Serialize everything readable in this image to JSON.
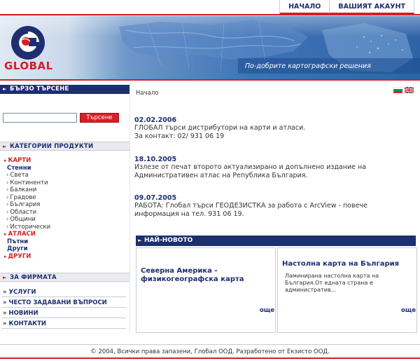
{
  "topnav": {
    "home": "НАЧАЛО",
    "account": "ВАШИЯТ АКАУНТ"
  },
  "banner": {
    "logo_text": "GLOBAL",
    "slogan": "По-добрите картографски решения"
  },
  "quick_search": {
    "title": "БЪРЗО ТЪРСЕНЕ",
    "button": "Търсене",
    "input_value": ""
  },
  "categories": {
    "title": "КАТЕГОРИИ ПРОДУКТИ",
    "items": [
      {
        "type": "main",
        "label": "КАРТИ"
      },
      {
        "type": "sub",
        "label": "Стенни"
      },
      {
        "type": "subsub",
        "label": "Света"
      },
      {
        "type": "subsub",
        "label": "Континенти"
      },
      {
        "type": "subsub",
        "label": "Балкани"
      },
      {
        "type": "subsub",
        "label": "Градове"
      },
      {
        "type": "subsub",
        "label": "България"
      },
      {
        "type": "subsub",
        "label": "Области"
      },
      {
        "type": "subsub",
        "label": "Общини"
      },
      {
        "type": "subsub",
        "label": "Исторически"
      },
      {
        "type": "main",
        "label": "АТЛАСИ"
      },
      {
        "type": "sub",
        "label": "Пътни"
      },
      {
        "type": "sub",
        "label": "Други"
      },
      {
        "type": "main",
        "label": "ДРУГИ"
      }
    ]
  },
  "firm": {
    "title": "ЗА ФИРМАТА",
    "items": [
      "УСЛУГИ",
      "ЧЕСТО ЗАДАВАНИ ВЪПРОСИ",
      "НОВИНИ",
      "КОНТАКТИ"
    ]
  },
  "breadcrumb": "Начало",
  "news": [
    {
      "date": "02.02.2006",
      "lines": [
        "ГЛОБАЛ търси дистрибутори на карти и атласи.",
        "За контакт: 02/ 931 06 19"
      ]
    },
    {
      "date": "18.10.2005",
      "lines": [
        "Излезе от печат второто актуализирано и допълнено издание на",
        "Административен атлас на Република България."
      ]
    },
    {
      "date": "09.07.2005",
      "lines": [
        "РАБОТА: Глобал търси ГЕОДЕЗИСТКА за работа с ArcView - повече",
        "информация на тел. 931 06 19."
      ]
    }
  ],
  "latest": {
    "title": "НАЙ-НОВОТО",
    "items": [
      {
        "title_lines": [
          "Северна Америка -",
          "физикогеографска карта"
        ],
        "desc_lines": [],
        "more": "още"
      },
      {
        "title_lines": [
          "Настолна карта на България"
        ],
        "desc_lines": [
          "Ламинирана настолна карта на",
          "България.От едната страна е",
          "административ..."
        ],
        "more": "още"
      }
    ]
  },
  "footer": "© 2004, Всички права запазени, Глобал ООД. Разработено от Екзисто ООД.",
  "colors": {
    "brand_navy": "#1d2f6e",
    "accent_red": "#d51f26",
    "banner_blue": "#3a6fb3"
  }
}
